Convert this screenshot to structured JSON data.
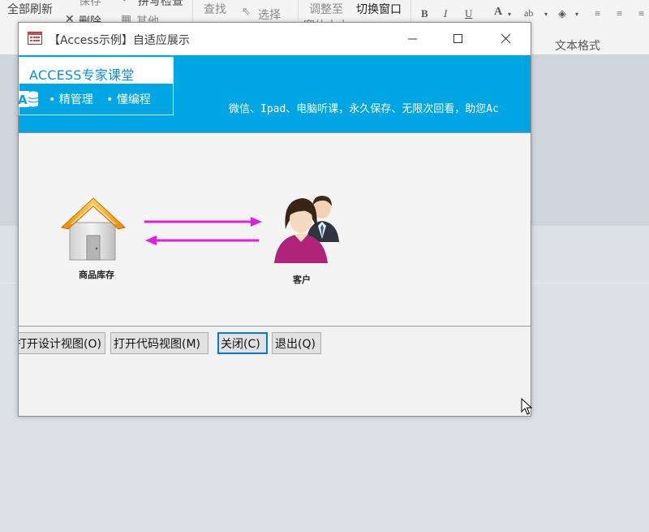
{
  "ribbon": {
    "refresh_all": "全部刷新",
    "save": "保存",
    "spell_check": "拼写检查",
    "delete": "删除",
    "other": "其他",
    "find": "查找",
    "select": "选择",
    "adjust_to": "调整至",
    "window_size": "窗体大小",
    "switch_window": "切换窗口",
    "text_format": "文本格式",
    "bold": "B",
    "italic": "I",
    "underline": "U"
  },
  "window": {
    "title": "【Access示例】自适应展示"
  },
  "banner": {
    "logo_title": "ACCESS专家课堂",
    "item1": "• 精管理",
    "item2": "• 懂编程",
    "marquee": "微信、Ipad、电脑听课，永久保存、无限次回看，助您Ac"
  },
  "content": {
    "warehouse_label": "商品库存",
    "customer_label": "客户"
  },
  "buttons": {
    "open_design": "打开设计视图(O)",
    "open_code": "打开代码视图(M)",
    "close": "关闭(C)",
    "exit": "退出(Q)"
  },
  "colors": {
    "banner": "#00a6e3",
    "arrow": "#e020d8",
    "focus": "#0078d7"
  }
}
